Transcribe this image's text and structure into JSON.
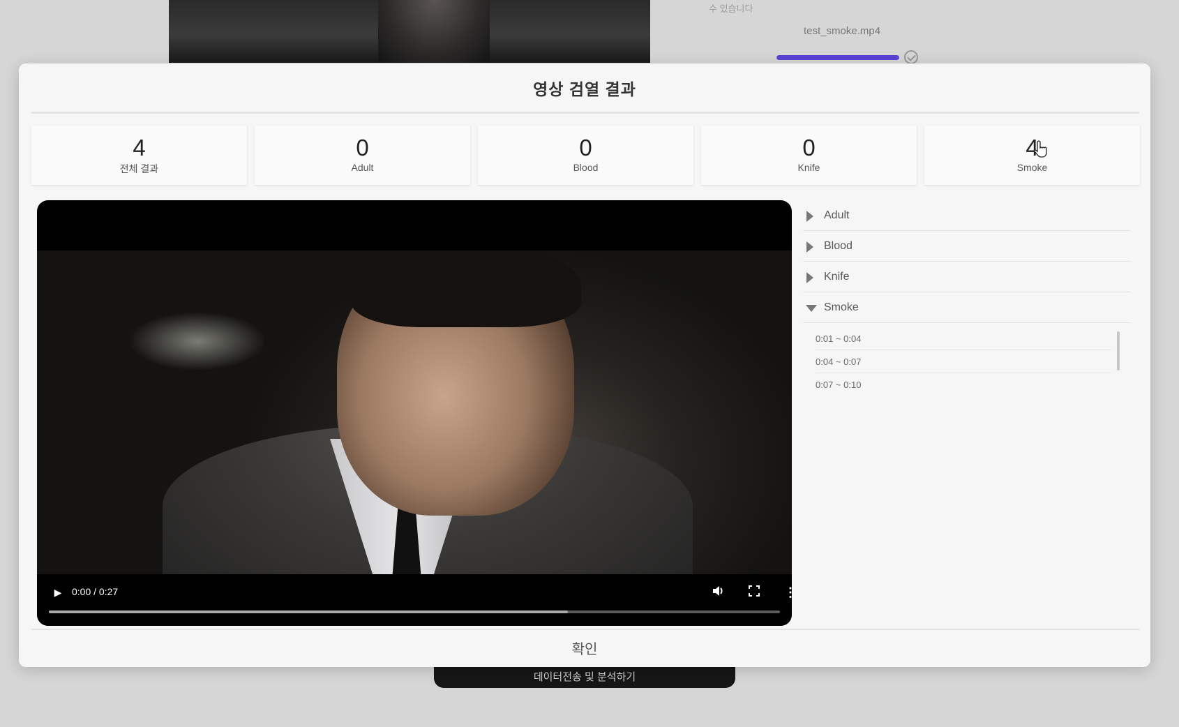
{
  "background": {
    "hint_text": "수 있습니다",
    "file_name": "test_smoke.mp4",
    "upload_progress": 1.0,
    "action_button_label": "데이터전송 및 분석하기"
  },
  "modal": {
    "title": "영상 검열 결과",
    "stats": [
      {
        "value": "4",
        "label": "전체 결과"
      },
      {
        "value": "0",
        "label": "Adult"
      },
      {
        "value": "0",
        "label": "Blood"
      },
      {
        "value": "0",
        "label": "Knife"
      },
      {
        "value": "4",
        "label": "Smoke"
      }
    ],
    "player": {
      "time": "0:00 / 0:27",
      "buffered_fraction": 0.71
    },
    "categories": [
      {
        "label": "Adult",
        "expanded": false
      },
      {
        "label": "Blood",
        "expanded": false
      },
      {
        "label": "Knife",
        "expanded": false
      },
      {
        "label": "Smoke",
        "expanded": true
      }
    ],
    "segments": [
      "0:01 ~ 0:04",
      "0:04 ~ 0:07",
      "0:07 ~ 0:10"
    ],
    "confirm_label": "확인"
  }
}
